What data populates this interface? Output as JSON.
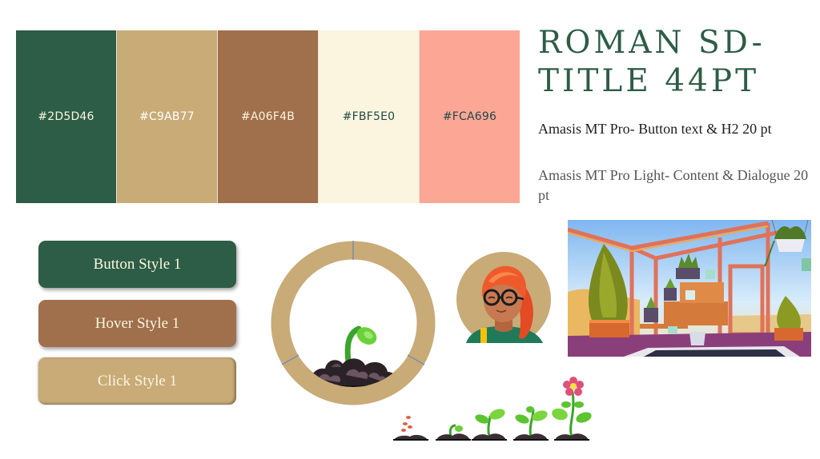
{
  "palette": {
    "swatches": [
      {
        "hex": "#2D5D46",
        "label": "#2D5D46",
        "text_color": "#FBF5E0"
      },
      {
        "hex": "#C9AB77",
        "label": "#C9AB77",
        "text_color": "#FFFFFF"
      },
      {
        "hex": "#A06F4B",
        "label": "#A06F4B",
        "text_color": "#FBF5E0"
      },
      {
        "hex": "#FBF5E0",
        "label": "#FBF5E0",
        "text_color": "#1F4A44"
      },
      {
        "hex": "#FCA696",
        "label": "#FCA696",
        "text_color": "#1F4A44"
      }
    ]
  },
  "typography": {
    "title_spec": "ROMAN SD- TITLE 44PT",
    "h2_spec": "Amasis MT Pro- Button text & H2 20 pt",
    "content_spec": "Amasis MT Pro Light- Content & Dialogue 20 pt"
  },
  "buttons": {
    "default_label": "Button Style 1",
    "hover_label": "Hover Style 1",
    "click_label": "Click Style 1"
  },
  "progress_ring": {
    "segments": 3,
    "ring_color": "#C9AB77",
    "divider_color": "#6B86B8",
    "icon": "sprout-in-soil-icon"
  },
  "avatar": {
    "icon": "girl-with-glasses-avatar",
    "background_color": "#C9AB77"
  },
  "illustration": {
    "icon": "greenhouse-interior-illustration"
  },
  "growth_stages": [
    {
      "icon": "seeds-stage-icon"
    },
    {
      "icon": "sprout-stage-icon"
    },
    {
      "icon": "seedling-stage-icon"
    },
    {
      "icon": "young-plant-stage-icon"
    },
    {
      "icon": "flowering-plant-stage-icon"
    }
  ]
}
